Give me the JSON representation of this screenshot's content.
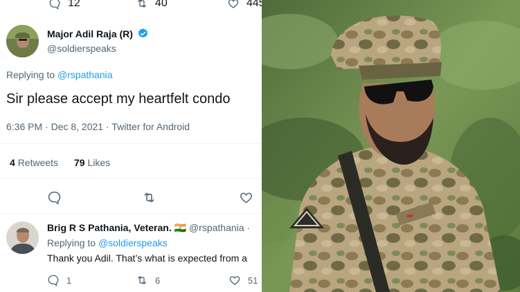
{
  "top_actions": {
    "replies": "12",
    "retweets": "40",
    "likes": "445"
  },
  "main_tweet": {
    "display_name": "Major Adil Raja (R)",
    "handle": "@soldierspeaks",
    "replying_prefix": "Replying to",
    "replying_to": "@rspathania",
    "text": "Sir please accept my heartfelt condo",
    "timestamp": "6:36 PM · Dec 8, 2021 · Twitter for Android",
    "retweet_count": "4",
    "retweet_label": "Retweets",
    "like_count": "79",
    "like_label": "Likes"
  },
  "reply_tweet": {
    "display_name": "Brig R S Pathania, Veteran.",
    "flag": "🇮🇳",
    "handle": "@rspathania",
    "separator": "·",
    "replying_prefix": "Replying to",
    "replying_to": "@soldierspeaks",
    "text": "Thank you Adil. That’s what is expected from a",
    "replies": "1",
    "retweets": "6",
    "likes": "51"
  },
  "colors": {
    "verified": "#1d9bf0",
    "link": "#1d9bf0",
    "secondary_text": "#536471",
    "divider": "#eff3f4"
  }
}
